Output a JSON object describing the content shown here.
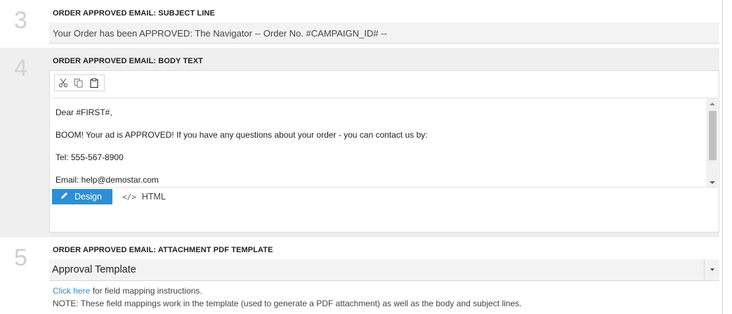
{
  "sections": {
    "s3": {
      "number": "3",
      "label": "ORDER APPROVED EMAIL: SUBJECT LINE",
      "value": "Your Order has been APPROVED: The Navigator -- Order No. #CAMPAIGN_ID# --"
    },
    "s4": {
      "number": "4",
      "label": "ORDER APPROVED EMAIL: BODY TEXT",
      "toolbar": {
        "icons": [
          "cut-icon",
          "copy-icon",
          "paste-icon"
        ]
      },
      "body_lines": [
        "Dear #FIRST#,",
        "BOOM!  Your ad is APPROVED!  If you have any questions about your order - you can contact us by:",
        "Tel: 555-567-8900",
        "Email: help@demostar.com"
      ],
      "design_label": "Design",
      "html_label": "HTML"
    },
    "s5": {
      "number": "5",
      "label": "ORDER APPROVED EMAIL: ATTACHMENT PDF TEMPLATE",
      "selected": "Approval Template",
      "link_text": "Click here",
      "link_suffix": " for field mapping instructions.",
      "note": "NOTE: These field mappings work in the template (used to generate a PDF attachment) as well as the body and subject lines."
    }
  },
  "colors": {
    "accent": "#2d8fd5",
    "section_bg": "#efefef",
    "field_bg": "#f3f3f3",
    "step_number": "#cfcfcf"
  }
}
